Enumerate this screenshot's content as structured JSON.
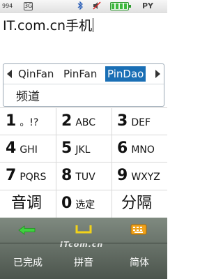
{
  "status_bar": {
    "signal_text": "994",
    "mode_badge": "3G",
    "ime_indicator": "PY",
    "battery_level": 1.0
  },
  "text_field": {
    "value": "IT.com.cn手机"
  },
  "candidates": {
    "pinyin": [
      "QinFan",
      "PinFan",
      "PinDao"
    ],
    "selected_index": 2,
    "words": [
      "频道"
    ]
  },
  "keypad": {
    "rows": [
      [
        {
          "digit": "1",
          "letters": "。!?"
        },
        {
          "digit": "2",
          "letters": "ABC"
        },
        {
          "digit": "3",
          "letters": "DEF"
        }
      ],
      [
        {
          "digit": "4",
          "letters": "GHI"
        },
        {
          "digit": "5",
          "letters": "JKL"
        },
        {
          "digit": "6",
          "letters": "MNO"
        }
      ],
      [
        {
          "digit": "7",
          "letters": "PQRS"
        },
        {
          "digit": "8",
          "letters": "TUV"
        },
        {
          "digit": "9",
          "letters": "WXYZ"
        }
      ]
    ],
    "bottom": {
      "left": "音调",
      "zero_digit": "0",
      "zero_label": "选定",
      "right": "分隔"
    }
  },
  "softkeys": {
    "left_label": "已完成",
    "middle_label": "拼音",
    "right_label": "简体",
    "icons": [
      "back-arrow-icon",
      "space-icon",
      "keyboard-icon"
    ],
    "watermark": "ITcom.cn"
  }
}
